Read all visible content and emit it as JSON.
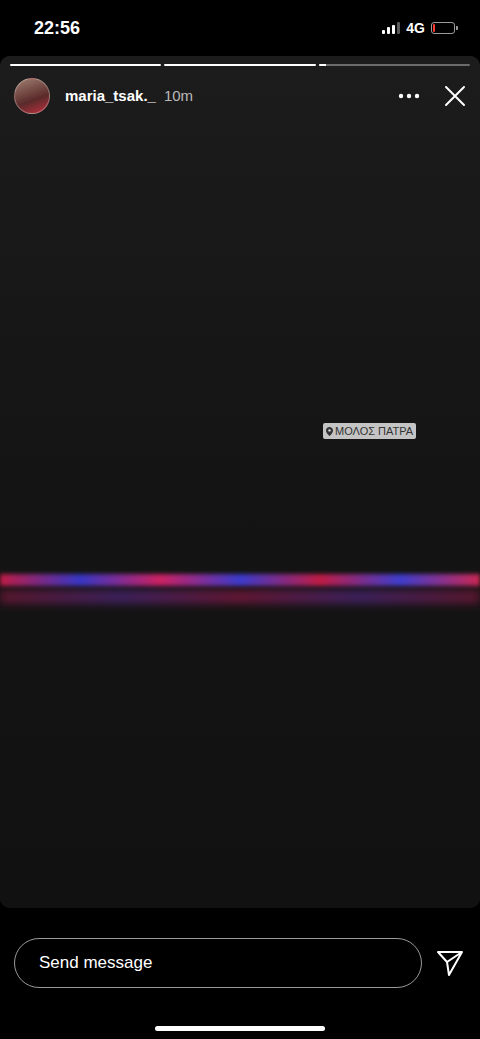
{
  "status_bar": {
    "time": "22:56",
    "network": "4G",
    "signal": {
      "level": 0.75
    },
    "battery": {
      "level": 0.1,
      "low": true
    }
  },
  "story": {
    "progress": [
      {
        "level": 1
      },
      {
        "level": 1
      },
      {
        "level": 0.05
      }
    ],
    "user": "maria_tsak._",
    "time": "10m",
    "location": "ΜΟΛΟΣ ΠΑΤΡΑ"
  },
  "reply": {
    "placeholder": "Send message"
  }
}
